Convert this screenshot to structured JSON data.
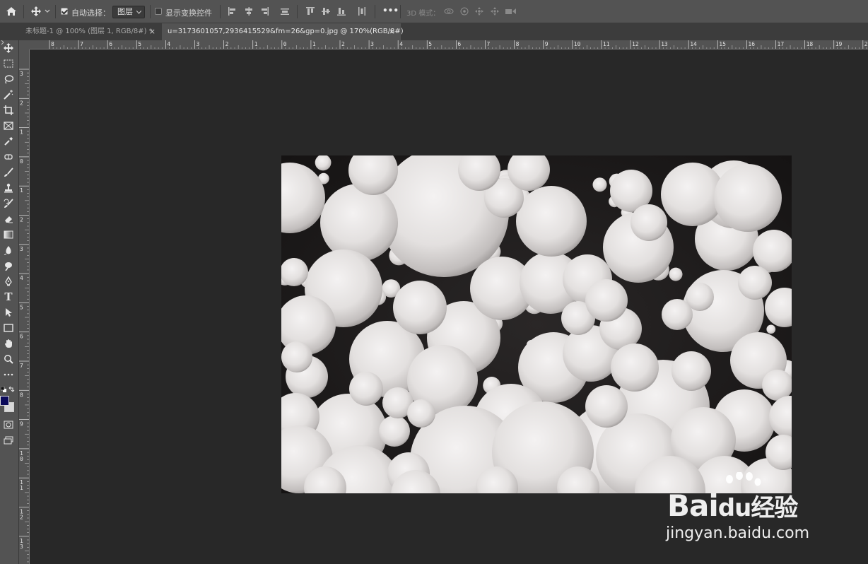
{
  "options_bar": {
    "auto_select_label": "自动选择：",
    "layer_select_value": "图层",
    "show_transform_label": "显示变换控件",
    "mode_3d_label": "3D 模式：",
    "more_label": "•••"
  },
  "tabs": [
    {
      "label": "未标题-1 @ 100% (图层 1, RGB/8#) *",
      "active": false
    },
    {
      "label": "u=3173601057,2936415529&fm=26&gp=0.jpg @ 170%(RGB/8#)",
      "active": true
    }
  ],
  "tab_close_glyph": "×",
  "ruler": {
    "h_labels": [
      "8",
      "7",
      "6",
      "5",
      "4",
      "3",
      "2",
      "1",
      "0",
      "1",
      "2",
      "3",
      "4",
      "5",
      "6",
      "7",
      "8",
      "9",
      "10",
      "11",
      "12",
      "13",
      "14",
      "15",
      "16",
      "17",
      "18",
      "19",
      "20"
    ],
    "v_labels": [
      "3",
      "2",
      "1",
      "0",
      "1",
      "2",
      "3",
      "4",
      "5",
      "6",
      "7",
      "8",
      "9",
      "10",
      "11",
      "12",
      "13"
    ]
  },
  "tools": [
    "move-tool-icon",
    "rect-marquee-icon",
    "lasso-icon",
    "magic-wand-icon",
    "crop-icon",
    "frame-icon",
    "eyedropper-icon",
    "healing-brush-icon",
    "brush-icon",
    "clone-stamp-icon",
    "history-brush-icon",
    "eraser-icon",
    "gradient-icon",
    "blur-icon",
    "dodge-icon",
    "pen-icon",
    "type-icon",
    "path-select-icon",
    "rectangle-icon",
    "hand-icon",
    "zoom-icon",
    "more-tools-icon"
  ],
  "colors": {
    "foreground": "#0b0a5a",
    "background": "#d8d8d8"
  },
  "type_tool_glyph": "T",
  "watermark": {
    "brand_left": "Bai",
    "brand_mid": "du",
    "brand_right": "经验",
    "url": "jingyan.baidu.com"
  }
}
